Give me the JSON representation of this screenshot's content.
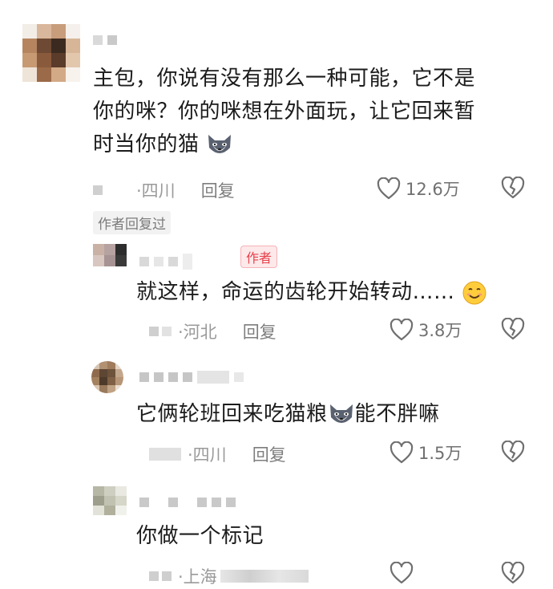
{
  "comments": [
    {
      "text_lines": [
        "主包，你说有没有那么一种可能，它不是",
        "你的咪？你的咪想在外面玩，让它回来暂",
        "时当你的猫"
      ],
      "location": "·四川",
      "reply": "回复",
      "likes": "12.6万",
      "author_replied_tag": "作者回复过"
    }
  ],
  "replies": [
    {
      "badge": "作者",
      "text": "就这样，命运的齿轮开始转动……",
      "location": "·河北",
      "reply": "回复",
      "likes": "3.8万"
    },
    {
      "text_a": "它俩轮班回来吃猫粮",
      "text_b": "能不胖嘛",
      "location": "·四川",
      "reply": "回复",
      "likes": "1.5万"
    },
    {
      "text": "你做一个标记",
      "location": "·上海"
    }
  ],
  "icons": [
    "heart-outline-icon",
    "broken-heart-icon",
    "husky-emoji",
    "smile-emoji"
  ]
}
